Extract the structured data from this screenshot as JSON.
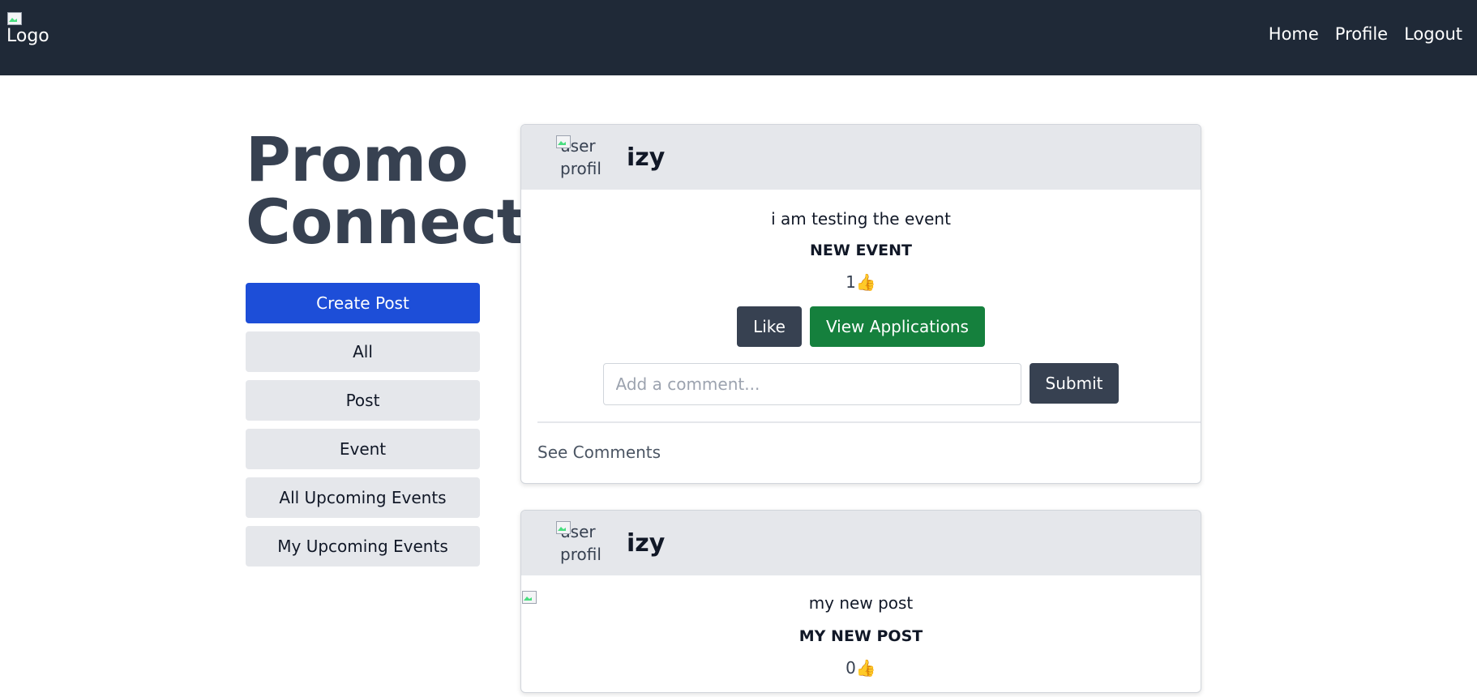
{
  "nav": {
    "logo_alt": "Logo",
    "links": [
      "Home",
      "Profile",
      "Logout"
    ]
  },
  "sidebar": {
    "title_line1": "Promo",
    "title_line2": "Connect",
    "buttons": [
      "Create Post",
      "All",
      "Post",
      "Event",
      "All Upcoming Events",
      "My Upcoming Events"
    ]
  },
  "posts": [
    {
      "avatar_alt_line1": "user",
      "avatar_alt_line2": "profile",
      "username": "izy",
      "text": "i am testing the event",
      "title": "NEW EVENT",
      "likes": "1",
      "like_icon": "thumbs-up-icon",
      "like_label": "Like",
      "view_applications_label": "View Applications",
      "comment_placeholder": "Add a comment...",
      "submit_label": "Submit",
      "see_comments": "See Comments"
    },
    {
      "avatar_alt_line1": "user",
      "avatar_alt_line2": "profile",
      "username": "izy",
      "image_alt": "my new post",
      "title": "MY NEW POST",
      "likes": "0",
      "like_icon": "thumbs-up-icon"
    }
  ],
  "colors": {
    "navbar": "#1f2937",
    "primary": "#1d4ed8",
    "success": "#15803d",
    "dark_button": "#374151"
  }
}
